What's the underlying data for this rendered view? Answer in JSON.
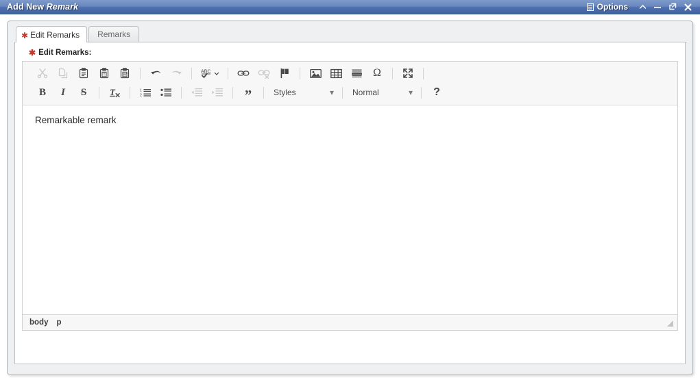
{
  "window": {
    "title_prefix": "Add New",
    "title_entity": "Remark",
    "options_label": "Options",
    "options_icon": "list-menu-icon",
    "controls": [
      {
        "name": "collapse-button",
        "icon": "chevron-up-icon"
      },
      {
        "name": "minimize-button",
        "icon": "minus-icon"
      },
      {
        "name": "maximize-button",
        "icon": "external-link-icon"
      },
      {
        "name": "close-button",
        "icon": "close-x-icon"
      }
    ]
  },
  "tabs": [
    {
      "label": "Edit Remarks",
      "active": true,
      "required": true
    },
    {
      "label": "Remarks",
      "active": false,
      "required": false
    }
  ],
  "field": {
    "label": "Edit Remarks:",
    "required_marker": "✱"
  },
  "editor": {
    "toolbar_row1": [
      {
        "name": "cut-button",
        "icon": "scissors-icon",
        "tooltip": "Cut",
        "disabled": true
      },
      {
        "name": "copy-button",
        "icon": "copy-pages-icon",
        "tooltip": "Copy",
        "disabled": true
      },
      {
        "name": "paste-button",
        "icon": "clipboard-icon",
        "tooltip": "Paste",
        "disabled": false
      },
      {
        "name": "paste-text-button",
        "icon": "clipboard-text-icon",
        "tooltip": "Paste as plain text",
        "disabled": false
      },
      {
        "name": "paste-word-button",
        "icon": "clipboard-word-icon",
        "tooltip": "Paste from Word",
        "disabled": false
      },
      {
        "name": "undo-button",
        "icon": "undo-arrow-icon",
        "tooltip": "Undo",
        "disabled": false
      },
      {
        "name": "redo-button",
        "icon": "redo-arrow-icon",
        "tooltip": "Redo",
        "disabled": true
      },
      {
        "name": "spellcheck-button",
        "icon": "abc-check-icon",
        "tooltip": "Spell Check As You Type",
        "disabled": false
      },
      {
        "name": "link-button",
        "icon": "chain-link-icon",
        "tooltip": "Link",
        "disabled": false
      },
      {
        "name": "unlink-button",
        "icon": "chain-broken-icon",
        "tooltip": "Unlink",
        "disabled": true
      },
      {
        "name": "anchor-button",
        "icon": "flag-icon",
        "tooltip": "Anchor",
        "disabled": false
      },
      {
        "name": "image-button",
        "icon": "image-icon",
        "tooltip": "Image",
        "disabled": false
      },
      {
        "name": "table-button",
        "icon": "table-grid-icon",
        "tooltip": "Table",
        "disabled": false
      },
      {
        "name": "horizontal-rule-button",
        "icon": "horizontal-lines-icon",
        "tooltip": "Horizontal Line",
        "disabled": false
      },
      {
        "name": "special-char-button",
        "icon": "omega-icon",
        "tooltip": "Insert Special Character",
        "disabled": false,
        "glyph": "Ω"
      },
      {
        "name": "maximize-editor-button",
        "icon": "expand-arrows-icon",
        "tooltip": "Maximize",
        "disabled": false
      }
    ],
    "toolbar_row2": [
      {
        "name": "bold-button",
        "icon": "bold-icon",
        "glyph": "B",
        "tooltip": "Bold",
        "disabled": false
      },
      {
        "name": "italic-button",
        "icon": "italic-icon",
        "glyph": "I",
        "tooltip": "Italic",
        "disabled": false
      },
      {
        "name": "strikethrough-button",
        "icon": "strikethrough-icon",
        "glyph": "S",
        "tooltip": "Strike Through",
        "disabled": false
      },
      {
        "name": "remove-format-button",
        "icon": "remove-format-icon",
        "tooltip": "Remove Format",
        "disabled": false
      },
      {
        "name": "numbered-list-button",
        "icon": "numbered-list-icon",
        "tooltip": "Insert/Remove Numbered List",
        "disabled": false
      },
      {
        "name": "bulleted-list-button",
        "icon": "bulleted-list-icon",
        "tooltip": "Insert/Remove Bulleted List",
        "disabled": false
      },
      {
        "name": "decrease-indent-button",
        "icon": "decrease-indent-icon",
        "tooltip": "Decrease Indent",
        "disabled": true
      },
      {
        "name": "increase-indent-button",
        "icon": "increase-indent-icon",
        "tooltip": "Increase Indent",
        "disabled": true
      },
      {
        "name": "blockquote-button",
        "icon": "quote-marks-icon",
        "glyph": "”",
        "tooltip": "Block Quote",
        "disabled": false
      },
      {
        "name": "about-button",
        "icon": "question-mark-icon",
        "glyph": "?",
        "tooltip": "About CKEditor",
        "disabled": false
      }
    ],
    "styles_dropdown": {
      "label": "Styles",
      "caret": "▾"
    },
    "format_dropdown": {
      "label": "Normal",
      "caret": "▾"
    },
    "content": "Remarkable remark",
    "element_path": [
      "body",
      "p"
    ]
  },
  "colors": {
    "titlebar_top": "#7e9acb",
    "titlebar_bottom": "#41639f",
    "panel_bg": "#eef0f2",
    "toolbar_bg": "#f7f7f7",
    "required_star": "#c0392b",
    "border": "#bcbfc3",
    "icon": "#474747",
    "icon_disabled": "#c9c9c9"
  }
}
